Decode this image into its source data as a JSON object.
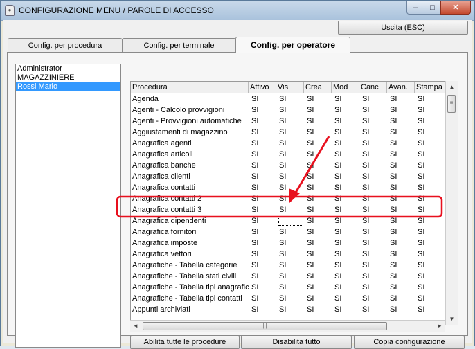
{
  "window": {
    "title": "CONFIGURAZIONE MENU / PAROLE DI ACCESSO",
    "minimize_glyph": "‒",
    "maximize_glyph": "□",
    "close_glyph": "✕"
  },
  "toolbar": {
    "exit_label": "Uscita (ESC)"
  },
  "tabs": [
    {
      "label": "Config. per procedura"
    },
    {
      "label": "Config. per terminale"
    },
    {
      "label": "Config. per operatore"
    }
  ],
  "operators": [
    {
      "name": "Administrator"
    },
    {
      "name": "MAGAZZINIERE"
    },
    {
      "name": "Rossi Mario"
    }
  ],
  "grid": {
    "columns": [
      "Procedura",
      "Attivo",
      "Vis",
      "Crea",
      "Mod",
      "Canc",
      "Avan.",
      "Stampa"
    ],
    "rows": [
      [
        "Agenda",
        "SI",
        "SI",
        "SI",
        "SI",
        "SI",
        "SI",
        "SI"
      ],
      [
        "Agenti - Calcolo provvigioni",
        "SI",
        "SI",
        "SI",
        "SI",
        "SI",
        "SI",
        "SI"
      ],
      [
        "Agenti - Provvigioni automatiche",
        "SI",
        "SI",
        "SI",
        "SI",
        "SI",
        "SI",
        "SI"
      ],
      [
        "Aggiustamenti di magazzino",
        "SI",
        "SI",
        "SI",
        "SI",
        "SI",
        "SI",
        "SI"
      ],
      [
        "Anagrafica agenti",
        "SI",
        "SI",
        "SI",
        "SI",
        "SI",
        "SI",
        "SI"
      ],
      [
        "Anagrafica articoli",
        "SI",
        "SI",
        "SI",
        "SI",
        "SI",
        "SI",
        "SI"
      ],
      [
        "Anagrafica banche",
        "SI",
        "SI",
        "SI",
        "SI",
        "SI",
        "SI",
        "SI"
      ],
      [
        "Anagrafica clienti",
        "SI",
        "SI",
        "SI",
        "SI",
        "SI",
        "SI",
        "SI"
      ],
      [
        "Anagrafica contatti",
        "SI",
        "SI",
        "SI",
        "SI",
        "SI",
        "SI",
        "SI"
      ],
      [
        "Anagrafica contatti 2",
        "SI",
        "SI",
        "SI",
        "SI",
        "SI",
        "SI",
        "SI"
      ],
      [
        "Anagrafica contatti 3",
        "SI",
        "SI",
        "SI",
        "SI",
        "SI",
        "SI",
        "SI"
      ],
      [
        "Anagrafica dipendenti",
        "SI",
        "",
        "SI",
        "SI",
        "SI",
        "SI",
        "SI"
      ],
      [
        "Anagrafica fornitori",
        "SI",
        "SI",
        "SI",
        "SI",
        "SI",
        "SI",
        "SI"
      ],
      [
        "Anagrafica imposte",
        "SI",
        "SI",
        "SI",
        "SI",
        "SI",
        "SI",
        "SI"
      ],
      [
        "Anagrafica vettori",
        "SI",
        "SI",
        "SI",
        "SI",
        "SI",
        "SI",
        "SI"
      ],
      [
        "Anagrafiche - Tabella categorie",
        "SI",
        "SI",
        "SI",
        "SI",
        "SI",
        "SI",
        "SI"
      ],
      [
        "Anagrafiche - Tabella stati civili",
        "SI",
        "SI",
        "SI",
        "SI",
        "SI",
        "SI",
        "SI"
      ],
      [
        "Anagrafiche - Tabella tipi anagrafic",
        "SI",
        "SI",
        "SI",
        "SI",
        "SI",
        "SI",
        "SI"
      ],
      [
        "Anagrafiche - Tabella tipi contatti",
        "SI",
        "SI",
        "SI",
        "SI",
        "SI",
        "SI",
        "SI"
      ],
      [
        "Appunti archiviati",
        "SI",
        "SI",
        "SI",
        "SI",
        "SI",
        "SI",
        "SI"
      ]
    ]
  },
  "scroll_glyphs": {
    "up": "▲",
    "down": "▼",
    "left": "◄",
    "right": "►",
    "grip_v": "≡",
    "grip_h": "|||"
  },
  "actions": {
    "enable_all": "Abilita tutte le procedure",
    "disable_all": "Disabilita tutto",
    "copy_config": "Copia configurazione"
  },
  "colors": {
    "annotation": "#e8101e",
    "selection": "#3399ff"
  }
}
